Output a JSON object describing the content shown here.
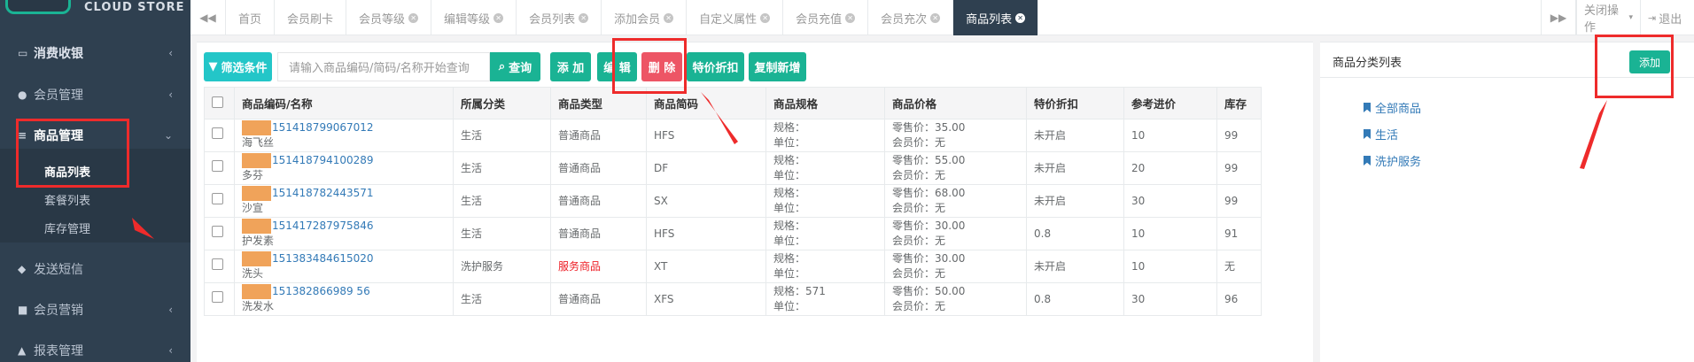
{
  "logo": {
    "text": "CLOUD  STORE"
  },
  "sidebar": {
    "items": [
      {
        "icon": "card-icon",
        "label": "消费收银"
      },
      {
        "icon": "user-icon",
        "label": "会员管理"
      },
      {
        "icon": "database-icon",
        "label": "商品管理"
      },
      {
        "icon": "comment-icon",
        "label": "发送短信"
      },
      {
        "icon": "briefcase-icon",
        "label": "会员营销"
      },
      {
        "icon": "chart-icon",
        "label": "报表管理"
      }
    ],
    "subitems": [
      "商品列表",
      "套餐列表",
      "库存管理"
    ]
  },
  "tabs": [
    {
      "label": "首页",
      "closable": false
    },
    {
      "label": "会员刷卡",
      "closable": false
    },
    {
      "label": "会员等级",
      "closable": true
    },
    {
      "label": "编辑等级",
      "closable": true
    },
    {
      "label": "会员列表",
      "closable": true
    },
    {
      "label": "添加会员",
      "closable": true
    },
    {
      "label": "自定义属性",
      "closable": true
    },
    {
      "label": "会员充值",
      "closable": true
    },
    {
      "label": "会员充次",
      "closable": true
    },
    {
      "label": "商品列表",
      "closable": true,
      "active": true
    }
  ],
  "tabbar": {
    "close_ops": "关闭操作",
    "logout": "退出"
  },
  "toolbar": {
    "filter": "筛选条件",
    "search_placeholder": "请输入商品编码/简码/名称开始查询",
    "query": "查询",
    "add": "添 加",
    "edit": "编 辑",
    "delete": "删 除",
    "discount": "特价折扣",
    "copy_new": "复制新增"
  },
  "table": {
    "columns": [
      "商品编码/名称",
      "所属分类",
      "商品类型",
      "商品简码",
      "商品规格",
      "商品价格",
      "特价折扣",
      "参考进价",
      "库存"
    ],
    "rows": [
      {
        "code": "151418799067012",
        "name": "海飞丝",
        "category": "生活",
        "type": "普通商品",
        "short": "HFS",
        "spec": "规格：",
        "unit": "单位：",
        "retail": "零售价：35.00",
        "member": "会员价：无",
        "discount": "未开启",
        "cost": "10",
        "stock": "99"
      },
      {
        "code": "151418794100289",
        "name": "多芬",
        "category": "生活",
        "type": "普通商品",
        "short": "DF",
        "spec": "规格：",
        "unit": "单位：",
        "retail": "零售价：55.00",
        "member": "会员价：无",
        "discount": "未开启",
        "cost": "20",
        "stock": "99"
      },
      {
        "code": "151418782443571",
        "name": "沙宣",
        "category": "生活",
        "type": "普通商品",
        "short": "SX",
        "spec": "规格：",
        "unit": "单位：",
        "retail": "零售价：68.00",
        "member": "会员价：无",
        "discount": "未开启",
        "cost": "30",
        "stock": "99"
      },
      {
        "code": "151417287975846",
        "name": "护发素",
        "category": "生活",
        "type": "普通商品",
        "short": "HFS",
        "spec": "规格：",
        "unit": "单位：",
        "retail": "零售价：30.00",
        "member": "会员价：无",
        "discount": "0.8",
        "cost": "10",
        "stock": "91"
      },
      {
        "code": "151383484615020",
        "name": "洗头",
        "category": "洗护服务",
        "type": "服务商品",
        "short": "XT",
        "spec": "规格：",
        "unit": "单位：",
        "retail": "零售价：30.00",
        "member": "会员价：无",
        "discount": "未开启",
        "cost": "10",
        "stock": "无"
      },
      {
        "code": "151382866989 56",
        "name": "洗发水",
        "category": "生活",
        "type": "普通商品",
        "short": "XFS",
        "spec": "规格：571",
        "unit": "单位：",
        "retail": "零售价：50.00",
        "member": "会员价：无",
        "discount": "0.8",
        "cost": "30",
        "stock": "96"
      }
    ]
  },
  "category_panel": {
    "title": "商品分类列表",
    "add": "添加",
    "items": [
      "全部商品",
      "生活",
      "洗护服务"
    ]
  },
  "colors": {
    "sidebar": "#2f4050",
    "primary": "#1ab394",
    "teal": "#23c6c8",
    "danger": "#ed5565",
    "annotation": "#ee2b2b"
  }
}
